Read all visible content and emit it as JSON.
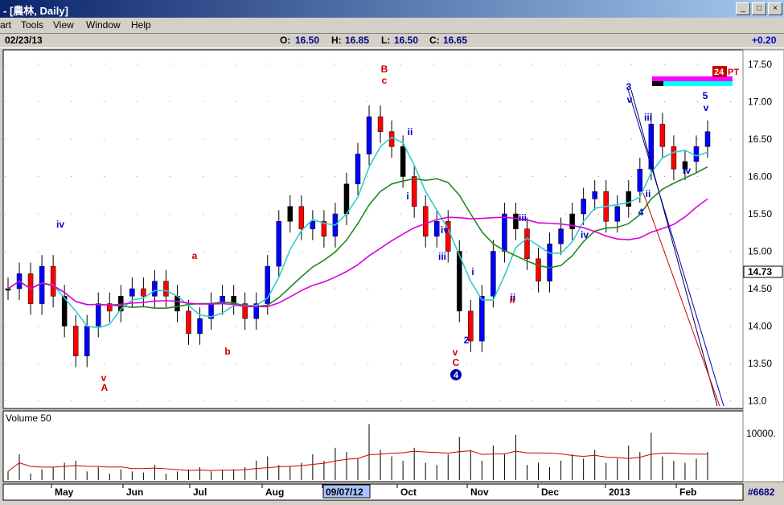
{
  "window": {
    "title": "- [農林, Daily]",
    "min_glyph": "_",
    "max_glyph": "□",
    "close_glyph": "×"
  },
  "menu": {
    "items": [
      "art",
      "Tools",
      "View",
      "Window",
      "Help"
    ]
  },
  "info": {
    "date": "02/23/13",
    "open_label": "O:",
    "open": "16.50",
    "high_label": "H:",
    "high": "16.85",
    "low_label": "L:",
    "low": "16.50",
    "close_label": "C:",
    "close": "16.65",
    "change": "+0.20"
  },
  "colors": {
    "up_blue": "#0000ff",
    "down_red": "#ff0000",
    "ma_cyan": "#33cccc",
    "ma_green": "#228822",
    "ma_magenta": "#dd00dd",
    "wave_blue": "#0000cc",
    "wave_red": "#cc0000"
  },
  "chart_data": {
    "type": "candlestick",
    "y_ticks": [
      "17.50",
      "17.00",
      "16.50",
      "16.00",
      "15.50",
      "15.00",
      "14.50",
      "14.00",
      "13.50",
      "13.0"
    ],
    "ylim": [
      13.0,
      17.65
    ],
    "last_price": "14.73",
    "x_labels": [
      "May",
      "Jun",
      "Jul",
      "Aug",
      "09/07/12",
      "Oct",
      "Nov",
      "Dec",
      "2013",
      "Feb"
    ],
    "volume_label": "Volume 50",
    "volume_tick": "10000.",
    "bar_count": "#6682",
    "badge": "24",
    "badge_suffix": "PT",
    "wave_labels_blue": [
      "iv",
      "ii",
      "i",
      "iv",
      "iii",
      "i",
      "2",
      "iii",
      "ii",
      "iv",
      "3",
      "v",
      "iii",
      "ii",
      "4",
      "iv",
      "5",
      "v"
    ],
    "wave_labels_red": [
      "v",
      "A",
      "a",
      "b",
      "B",
      "c",
      "v",
      "C",
      "ii"
    ],
    "circle_label": "4",
    "price_path": [
      14.5,
      14.7,
      14.3,
      14.8,
      14.4,
      14.0,
      13.6,
      14.0,
      14.3,
      14.2,
      14.4,
      14.5,
      14.4,
      14.6,
      14.4,
      14.2,
      13.9,
      14.1,
      14.3,
      14.4,
      14.3,
      14.1,
      14.3,
      14.8,
      15.4,
      15.6,
      15.3,
      15.4,
      15.2,
      15.5,
      15.9,
      16.3,
      16.8,
      16.6,
      16.4,
      16.0,
      15.6,
      15.2,
      15.4,
      15.0,
      14.2,
      13.8,
      14.4,
      15.0,
      15.5,
      15.3,
      14.9,
      14.6,
      15.1,
      15.3,
      15.5,
      15.7,
      15.8,
      15.4,
      15.6,
      15.8,
      16.1,
      16.7,
      16.4,
      16.1,
      16.2,
      16.4,
      16.6
    ],
    "volume_values": [
      400,
      1200,
      300,
      500,
      600,
      800,
      900,
      400,
      600,
      300,
      500,
      400,
      350,
      700,
      300,
      400,
      500,
      600,
      400,
      450,
      500,
      600,
      900,
      1100,
      700,
      650,
      800,
      1200,
      900,
      1500,
      1300,
      1000,
      2600,
      1400,
      1100,
      900,
      1500,
      800,
      700,
      1200,
      2000,
      1400,
      900,
      1600,
      1200,
      2100,
      700,
      800,
      600,
      900,
      1200,
      1000,
      1400,
      800,
      1000,
      1600,
      1300,
      2200,
      1100,
      900,
      800,
      1000,
      1300
    ]
  }
}
